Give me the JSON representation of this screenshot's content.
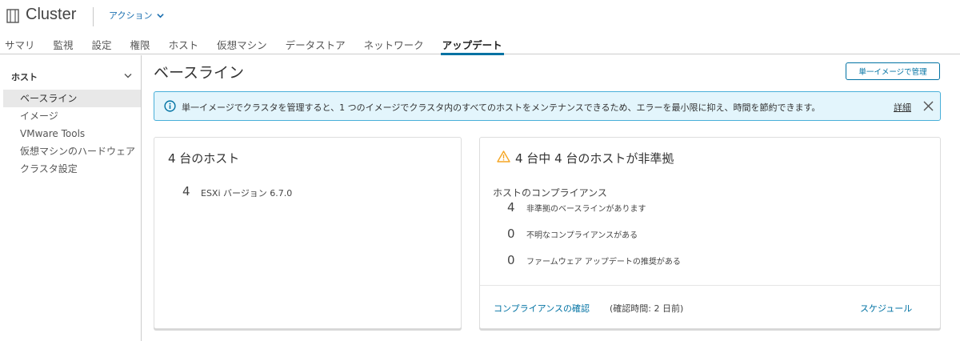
{
  "header": {
    "title": "Cluster",
    "actions_label": "アクション",
    "tabs": [
      {
        "label": "サマリ"
      },
      {
        "label": "監視"
      },
      {
        "label": "設定"
      },
      {
        "label": "権限"
      },
      {
        "label": "ホスト"
      },
      {
        "label": "仮想マシン"
      },
      {
        "label": "データストア"
      },
      {
        "label": "ネットワーク"
      },
      {
        "label": "アップデート",
        "active": true
      }
    ]
  },
  "sidebar": {
    "section_title": "ホスト",
    "items": [
      {
        "label": "ベースライン",
        "active": true
      },
      {
        "label": "イメージ"
      },
      {
        "label": "VMware Tools"
      },
      {
        "label": "仮想マシンのハードウェア"
      },
      {
        "label": "クラスタ設定"
      }
    ]
  },
  "main": {
    "title": "ベースライン",
    "manage_button": "単一イメージで管理",
    "alert": {
      "text": "単一イメージでクラスタを管理すると、1 つのイメージでクラスタ内のすべてのホストをメンテナンスできるため、エラーを最小限に抑え、時間を節約できます。",
      "link": "詳細"
    },
    "hosts_card": {
      "title": "4 台のホスト",
      "count": "4",
      "version": "ESXi バージョン 6.7.0"
    },
    "compliance_card": {
      "title": "4 台中 4 台のホストが非準拠",
      "heading": "ホストのコンプライアンス",
      "rows": [
        {
          "count": "4",
          "label": "非準拠のベースラインがあります"
        },
        {
          "count": "0",
          "label": "不明なコンプライアンスがある"
        },
        {
          "count": "0",
          "label": "ファームウェア アップデートの推奨がある"
        }
      ],
      "check_link": "コンプライアンスの確認",
      "check_time": "(確認時間: 2 日前)",
      "schedule_link": "スケジュール"
    }
  },
  "colors": {
    "accent": "#0072a3",
    "alert_bg": "#e3f5fc",
    "alert_border": "#49afd9",
    "warning": "#f5a623"
  }
}
